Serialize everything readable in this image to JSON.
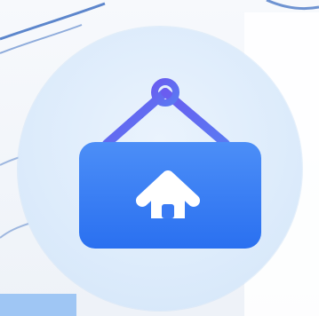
{
  "icon": {
    "name": "home-sign-icon",
    "sign_color_top": "#4C8EF7",
    "sign_color_bottom": "#2A70F0",
    "cord_color": "#6A5CF0",
    "circle_color": "#DCEBFB",
    "house_color": "#FFFFFF"
  },
  "background": {
    "base_color": "#F2F4F8",
    "line_color": "#4B79C6",
    "strip_color": "#9FC6F4"
  }
}
